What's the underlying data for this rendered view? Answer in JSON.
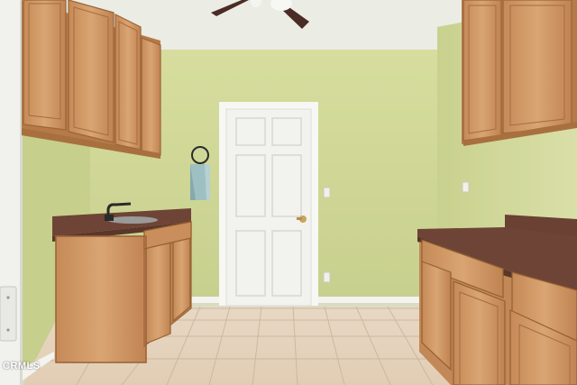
{
  "photo": {
    "subject": "laundry-room",
    "watermark": "CRMLS"
  },
  "palette": {
    "wall": "#cfd89a",
    "ceiling": "#eceee6",
    "cabinet": "#c98f5c",
    "countertop": "#6e4436",
    "door": "#f3f3f1",
    "floor": "#e6d4bf",
    "baseboard": "#f2f2ee"
  }
}
